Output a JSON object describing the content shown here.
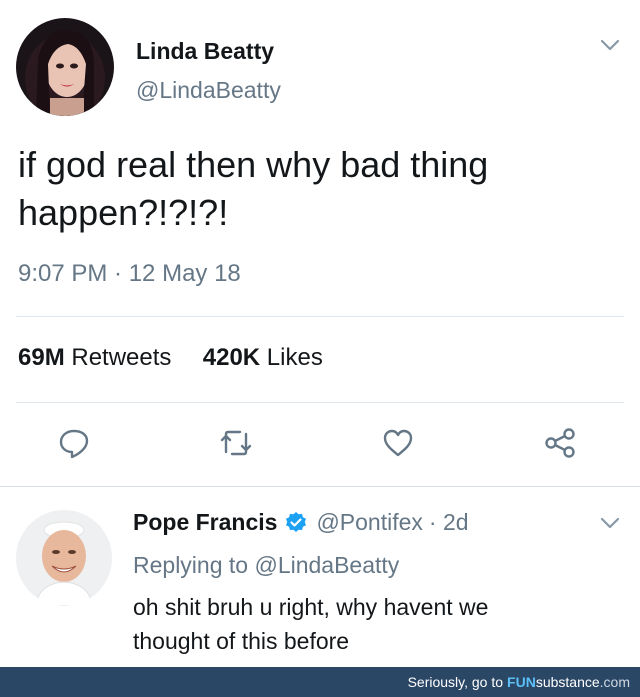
{
  "tweet": {
    "author_name": "Linda Beatty",
    "author_handle": "@LindaBeatty",
    "text_line1": "if god real then why bad thing",
    "text_line2": "happen?!?!?!",
    "timestamp": "9:07 PM · 12 May 18",
    "retweets_count": "69M",
    "retweets_label": "Retweets",
    "likes_count": "420K",
    "likes_label": "Likes"
  },
  "reply": {
    "author_name": "Pope Francis",
    "author_handle": "@Pontifex",
    "age": "· 2d",
    "replying_prefix": "Replying to ",
    "replying_to": "@LindaBeatty",
    "text_line1": "oh shit bruh u right, why havent we",
    "text_line2": "thought of this before"
  },
  "footer": {
    "prefix": "Seriously, go to",
    "brand_a": "FUN",
    "brand_b": "substance",
    "brand_c": ".com"
  },
  "icons": {
    "reply": "reply-icon",
    "retweet": "retweet-icon",
    "like": "heart-icon",
    "share": "share-icon",
    "menu": "chevron-down-icon",
    "verified": "verified-badge-icon"
  },
  "colors": {
    "text": "#14171a",
    "muted": "#657786",
    "verified": "#1da1f2",
    "footer_bg": "#2b4766"
  }
}
